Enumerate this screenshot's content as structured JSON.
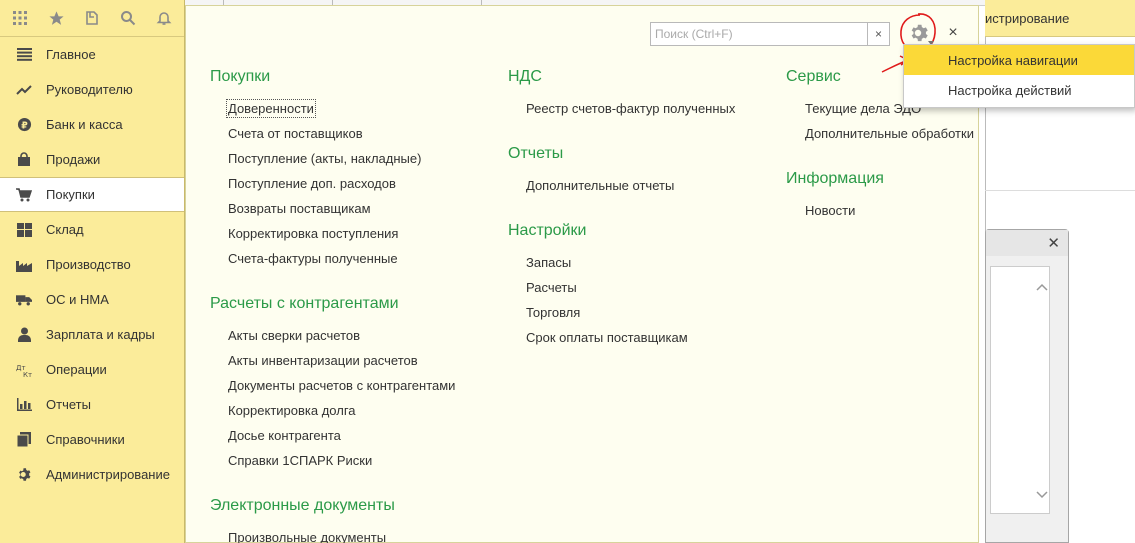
{
  "topbar": {
    "icons": [
      "apps-grid-icon",
      "star-icon",
      "history-icon",
      "search-icon",
      "bell-icon"
    ]
  },
  "sidebar": {
    "items": [
      {
        "label": "Главное",
        "icon": "menu-lines-icon"
      },
      {
        "label": "Руководителю",
        "icon": "trend-icon"
      },
      {
        "label": "Банк и касса",
        "icon": "coin-icon"
      },
      {
        "label": "Продажи",
        "icon": "bag-icon"
      },
      {
        "label": "Покупки",
        "icon": "cart-icon",
        "active": true
      },
      {
        "label": "Склад",
        "icon": "warehouse-icon"
      },
      {
        "label": "Производство",
        "icon": "factory-icon"
      },
      {
        "label": "ОС и НМА",
        "icon": "truck-icon"
      },
      {
        "label": "Зарплата и кадры",
        "icon": "person-icon"
      },
      {
        "label": "Операции",
        "icon": "debit-credit-icon"
      },
      {
        "label": "Отчеты",
        "icon": "bar-chart-icon"
      },
      {
        "label": "Справочники",
        "icon": "books-icon"
      },
      {
        "label": "Администрирование",
        "icon": "gear-icon"
      }
    ]
  },
  "background": {
    "tab_label": "истрирование"
  },
  "panel": {
    "search_placeholder": "Поиск (Ctrl+F)",
    "clear_label": "×",
    "close_label": "×",
    "columns": [
      {
        "sections": [
          {
            "title": "Покупки",
            "links": [
              "Доверенности",
              "Счета от поставщиков",
              "Поступление (акты, накладные)",
              "Поступление доп. расходов",
              "Возвраты поставщикам",
              "Корректировка поступления",
              "Счета-фактуры полученные"
            ]
          },
          {
            "title": "Расчеты с контрагентами",
            "links": [
              "Акты сверки расчетов",
              "Акты инвентаризации расчетов",
              "Документы расчетов с контрагентами",
              "Корректировка долга",
              "Досье контрагента",
              "Справки 1СПАРК Риски"
            ]
          },
          {
            "title": "Электронные документы",
            "links": [
              "Произвольные документы"
            ]
          }
        ]
      },
      {
        "sections": [
          {
            "title": "НДС",
            "links": [
              "Реестр счетов-фактур полученных"
            ]
          },
          {
            "title": "Отчеты",
            "links": [
              "Дополнительные отчеты"
            ]
          },
          {
            "title": "Настройки",
            "links": [
              "Запасы",
              "Расчеты",
              "Торговля",
              "Срок оплаты поставщикам"
            ]
          }
        ]
      },
      {
        "sections": [
          {
            "title": "Сервис",
            "links": [
              "Текущие дела ЭДО",
              "Дополнительные обработки"
            ]
          },
          {
            "title": "Информация",
            "links": [
              "Новости"
            ]
          }
        ]
      }
    ]
  },
  "dropdown": {
    "items": [
      "Настройка навигации",
      "Настройка действий"
    ]
  },
  "colors": {
    "sidebar_bg": "#fbec9a",
    "panel_bg": "#fefef0",
    "section_title": "#2b9a48",
    "menu_highlight": "#fbd938",
    "annotation_red": "#e01b1b"
  }
}
